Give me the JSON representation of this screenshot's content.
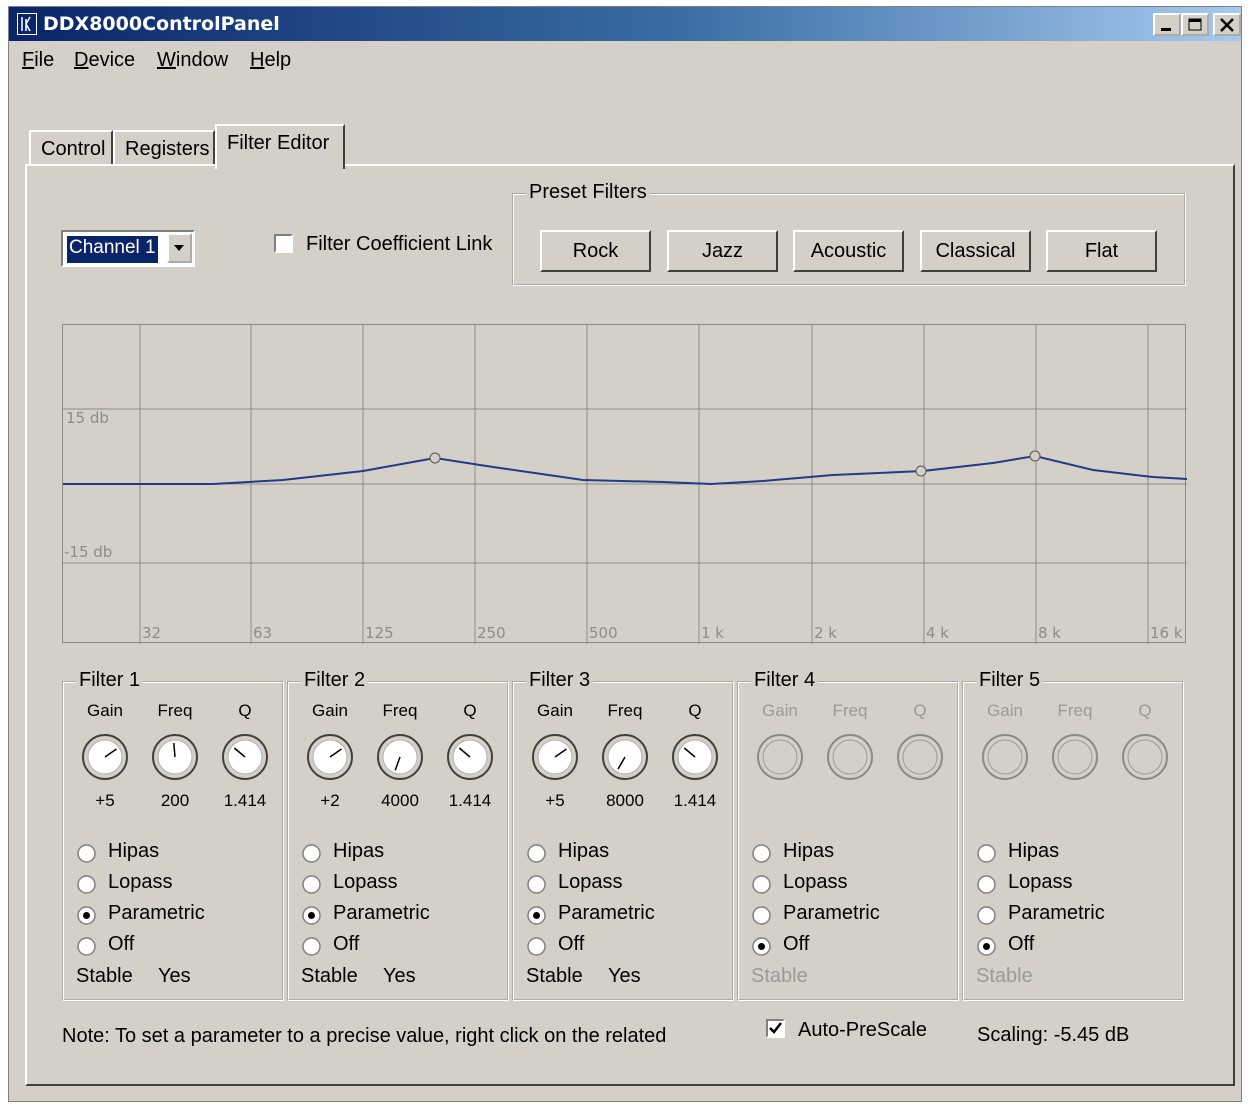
{
  "window": {
    "title": "DDX8000ControlPanel"
  },
  "menu": [
    "File",
    "Device",
    "Window",
    "Help"
  ],
  "tabs": [
    "Control",
    "Registers",
    "Filter Editor"
  ],
  "active_tab": "Filter Editor",
  "channel_select": {
    "value": "Channel 1"
  },
  "coefficient_link": {
    "label": "Filter Coefficient Link",
    "checked": false
  },
  "presets": {
    "title": "Preset Filters",
    "buttons": [
      "Rock",
      "Jazz",
      "Acoustic",
      "Classical",
      "Flat"
    ]
  },
  "graph": {
    "y_labels": [
      "15 db",
      "-15 db"
    ],
    "x_labels": [
      "32",
      "63",
      "125",
      "250",
      "500",
      "1 k",
      "2 k",
      "4 k",
      "8 k",
      "16 k"
    ],
    "curve_color": "#1f3b8c"
  },
  "knob_labels": [
    "Gain",
    "Freq",
    "Q"
  ],
  "filters": [
    {
      "title": "Filter 1",
      "enabled": true,
      "gain": "+5",
      "freq": "200",
      "q": "1.414",
      "types": [
        "Hipas",
        "Lopass",
        "Parametric",
        "Off"
      ],
      "selected": "Parametric",
      "stable_label": "Stable",
      "stable_value": "Yes"
    },
    {
      "title": "Filter 2",
      "enabled": true,
      "gain": "+2",
      "freq": "4000",
      "q": "1.414",
      "types": [
        "Hipas",
        "Lopass",
        "Parametric",
        "Off"
      ],
      "selected": "Parametric",
      "stable_label": "Stable",
      "stable_value": "Yes"
    },
    {
      "title": "Filter 3",
      "enabled": true,
      "gain": "+5",
      "freq": "8000",
      "q": "1.414",
      "types": [
        "Hipas",
        "Lopass",
        "Parametric",
        "Off"
      ],
      "selected": "Parametric",
      "stable_label": "Stable",
      "stable_value": "Yes"
    },
    {
      "title": "Filter 4",
      "enabled": false,
      "gain": "",
      "freq": "",
      "q": "",
      "types": [
        "Hipas",
        "Lopass",
        "Parametric",
        "Off"
      ],
      "selected": "Off",
      "stable_label": "Stable",
      "stable_value": ""
    },
    {
      "title": "Filter 5",
      "enabled": false,
      "gain": "",
      "freq": "",
      "q": "",
      "types": [
        "Hipas",
        "Lopass",
        "Parametric",
        "Off"
      ],
      "selected": "Off",
      "stable_label": "Stable",
      "stable_value": ""
    }
  ],
  "footer": {
    "note": "Note: To set a parameter to a precise value, right click on the related",
    "auto_prescale": {
      "label": "Auto-PreScale",
      "checked": true
    },
    "scaling": "Scaling: -5.45 dB"
  }
}
